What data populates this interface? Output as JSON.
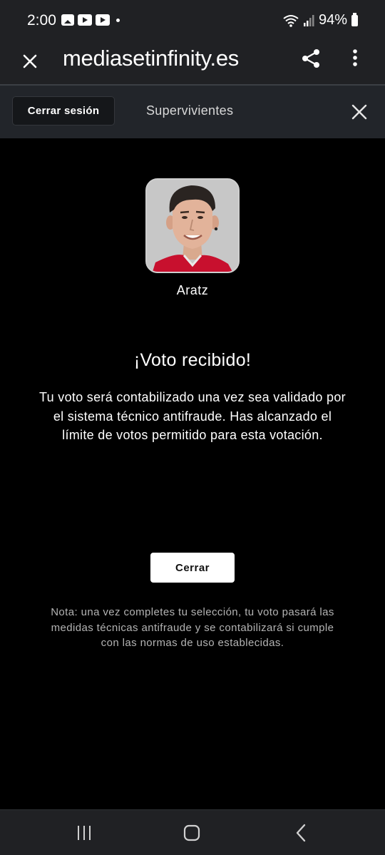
{
  "status_bar": {
    "time": "2:00",
    "battery": "94%",
    "icons": [
      "gallery-icon",
      "youtube-icon",
      "youtube-icon",
      "dot-icon",
      "wifi-icon",
      "signal-icon",
      "battery-icon"
    ]
  },
  "browser": {
    "url": "mediasetinfinity.es",
    "icons": [
      "close-icon",
      "share-icon",
      "more-vert-icon"
    ]
  },
  "modal_header": {
    "logout_label": "Cerrar sesión",
    "title": "Supervivientes",
    "icons": [
      "close-icon"
    ]
  },
  "candidate": {
    "name": "Aratz"
  },
  "result": {
    "title": "¡Voto recibido!",
    "message": "Tu voto será contabilizado una vez sea validado por el sistema técnico antifraude. Has alcanzado el límite de votos permitido para esta votación.",
    "close_label": "Cerrar",
    "note": "Nota: una vez completes tu selección, tu voto pasará las medidas técnicas antifraude y se contabilizará si cumple con las normas de uso establecidas."
  },
  "nav_bar": {
    "icons": [
      "recent-apps-icon",
      "home-icon",
      "back-icon"
    ]
  },
  "colors": {
    "background": "#000000",
    "chrome": "#202124",
    "modal_header": "#22252a",
    "jersey": "#c8102e"
  }
}
